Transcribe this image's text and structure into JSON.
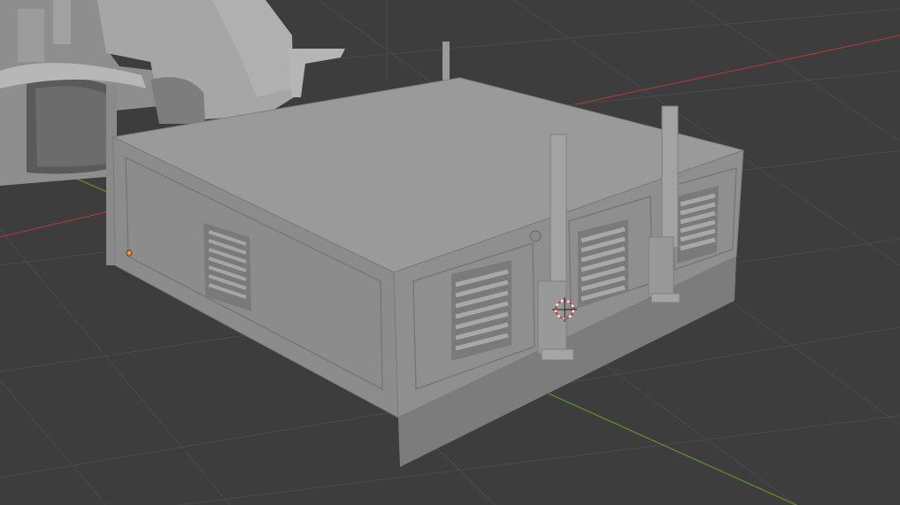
{
  "viewport": {
    "background": "#3d3d3d",
    "grid_color": "#4a4a4a",
    "x_axis_color": "#9b3a3a",
    "y_axis_color": "#5e8a2b"
  },
  "scene": {
    "tractor_color": "#a8a8a8",
    "box_top_color": "#9a9a9a",
    "box_side_color": "#8c8c8c",
    "box_front_color": "#8f8f8f",
    "icons": [
      "3d-cursor-icon",
      "origin-dot-icon"
    ]
  }
}
